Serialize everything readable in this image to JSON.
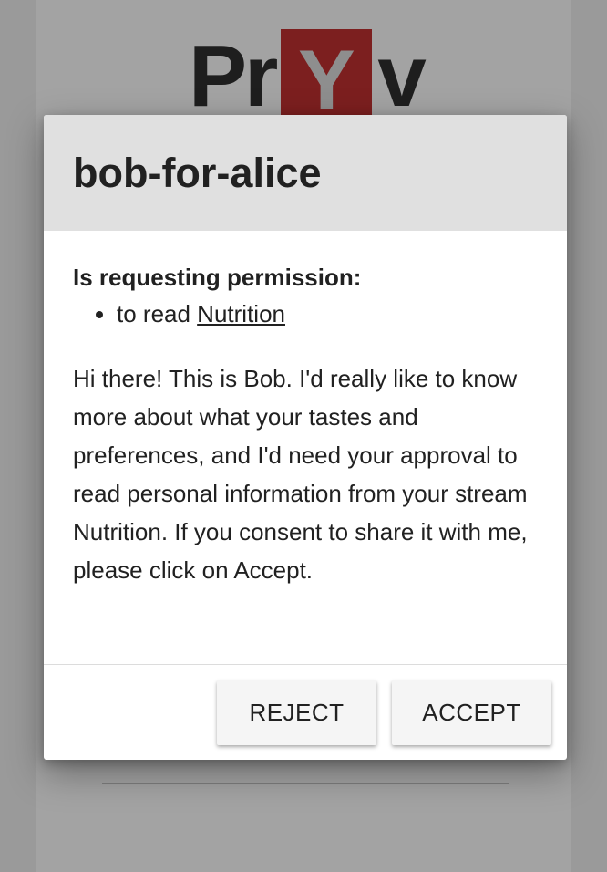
{
  "logo": {
    "left": "Pr",
    "highlight": "Y",
    "right": "v",
    "highlight_color": "#7c1f1f"
  },
  "dialog": {
    "title": "bob-for-alice",
    "permission_heading": "Is requesting permission:",
    "permissions": [
      {
        "prefix": "to read ",
        "stream": "Nutrition"
      }
    ],
    "message": "Hi there! This is Bob. I'd really like to know more about what your tastes and preferences, and I'd need your approval to read personal information from your stream Nutrition. If you consent to share it with me, please click on Accept.",
    "reject_label": "REJECT",
    "accept_label": "ACCEPT"
  }
}
